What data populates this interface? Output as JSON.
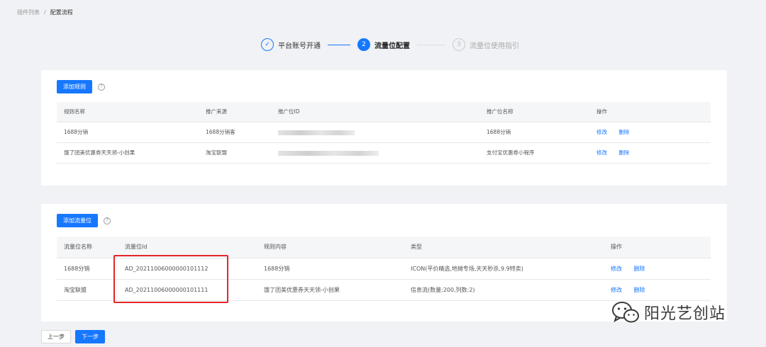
{
  "breadcrumb": {
    "parent": "插件列表",
    "separator": "/",
    "current": "配置流程"
  },
  "steps": [
    {
      "index": "✓",
      "title": "平台账号开通",
      "status": "done"
    },
    {
      "index": "2",
      "title": "流量位配置",
      "status": "active"
    },
    {
      "index": "3",
      "title": "流量位使用指引",
      "status": "wait"
    }
  ],
  "rules": {
    "add_label": "添加规则",
    "help_icon": "question-circle-icon",
    "columns": [
      "规则名称",
      "推广来源",
      "推广位ID",
      "推广位名称",
      "操作"
    ],
    "rows": [
      {
        "name": "1688分销",
        "source": "1688分销客",
        "pid_masked": true,
        "pid_name": "1688分销"
      },
      {
        "name": "饿了团美优惠券天天领-小创果",
        "source": "淘宝联盟",
        "pid_masked": true,
        "pid_name": "支付宝优惠券小程序"
      }
    ],
    "edit_label": "修改",
    "delete_label": "删除"
  },
  "slots": {
    "add_label": "添加流量位",
    "help_icon": "question-circle-icon",
    "columns": [
      "流量位名称",
      "流量位Id",
      "规则内容",
      "类型",
      "操作"
    ],
    "rows": [
      {
        "name": "1688分销",
        "id": "AD_20211006000000101112",
        "rule": "1688分销",
        "type": "ICON(平价精选,地摊专场,天天秒杀,9.9特卖)"
      },
      {
        "name": "淘宝联盟",
        "id": "AD_20211006000000101111",
        "rule": "饿了团美优惠券天天领-小创果",
        "type": "信息流(数量:200,列数:2)"
      }
    ],
    "edit_label": "修改",
    "delete_label": "删除"
  },
  "footer": {
    "prev_label": "上一步",
    "next_label": "下一步"
  },
  "watermark": {
    "icon": "wechat-icon",
    "text": "阳光艺创站"
  },
  "colors": {
    "primary": "#1677ff",
    "highlight": "#e5252a"
  }
}
